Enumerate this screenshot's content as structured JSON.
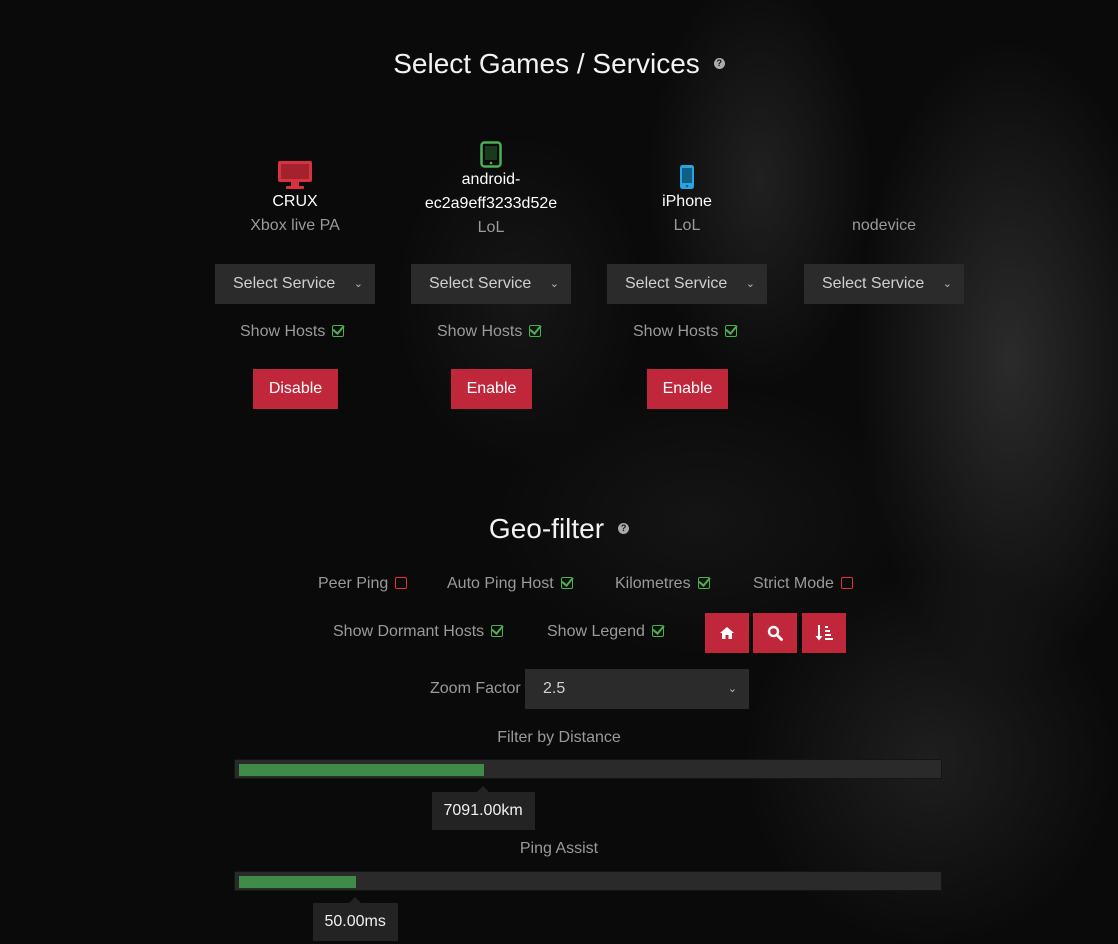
{
  "games": {
    "title": "Select Games / Services",
    "help_icon": "question-circle-icon",
    "devices": [
      {
        "name": "CRUX",
        "game": "Xbox live PA",
        "icon": "desktop-icon",
        "icon_color": "#d9313f",
        "select": "Select Service",
        "show_hosts_label": "Show Hosts",
        "show_hosts_checked": true,
        "action_label": "Disable"
      },
      {
        "name": "android-\nec2a9eff3233d52e",
        "game": "LoL",
        "icon": "tablet-icon",
        "icon_color": "#4caf50",
        "select": "Select Service",
        "show_hosts_label": "Show Hosts",
        "show_hosts_checked": true,
        "action_label": "Enable"
      },
      {
        "name": "iPhone",
        "game": "LoL",
        "icon": "phone-icon",
        "icon_color": "#2aa4de",
        "select": "Select Service",
        "show_hosts_label": "Show Hosts",
        "show_hosts_checked": true,
        "action_label": "Enable"
      },
      {
        "name": "",
        "game": "nodevice",
        "select": "Select Service"
      }
    ]
  },
  "geo": {
    "title": "Geo-filter",
    "help_icon": "question-circle-icon",
    "options": {
      "peer_ping": {
        "label": "Peer Ping",
        "checked": false
      },
      "auto_ping_host": {
        "label": "Auto Ping Host",
        "checked": true
      },
      "kilometres": {
        "label": "Kilometres",
        "checked": true
      },
      "strict_mode": {
        "label": "Strict Mode",
        "checked": false
      },
      "show_dormant_hosts": {
        "label": "Show Dormant Hosts",
        "checked": true
      },
      "show_legend": {
        "label": "Show Legend",
        "checked": true
      }
    },
    "icon_buttons": [
      "home-icon",
      "search-icon",
      "sort-amount-icon"
    ],
    "zoom": {
      "label": "Zoom Factor",
      "value": "2.5"
    },
    "distance": {
      "label": "Filter by Distance",
      "value": "7091.00km",
      "fill_fraction": 0.35
    },
    "ping": {
      "label": "Ping Assist",
      "value": "50.00ms",
      "fill_fraction": 0.167
    }
  },
  "colors": {
    "accent_red": "#c0273a",
    "check_green": "#4caf50",
    "slider_green": "#3f8c48"
  }
}
